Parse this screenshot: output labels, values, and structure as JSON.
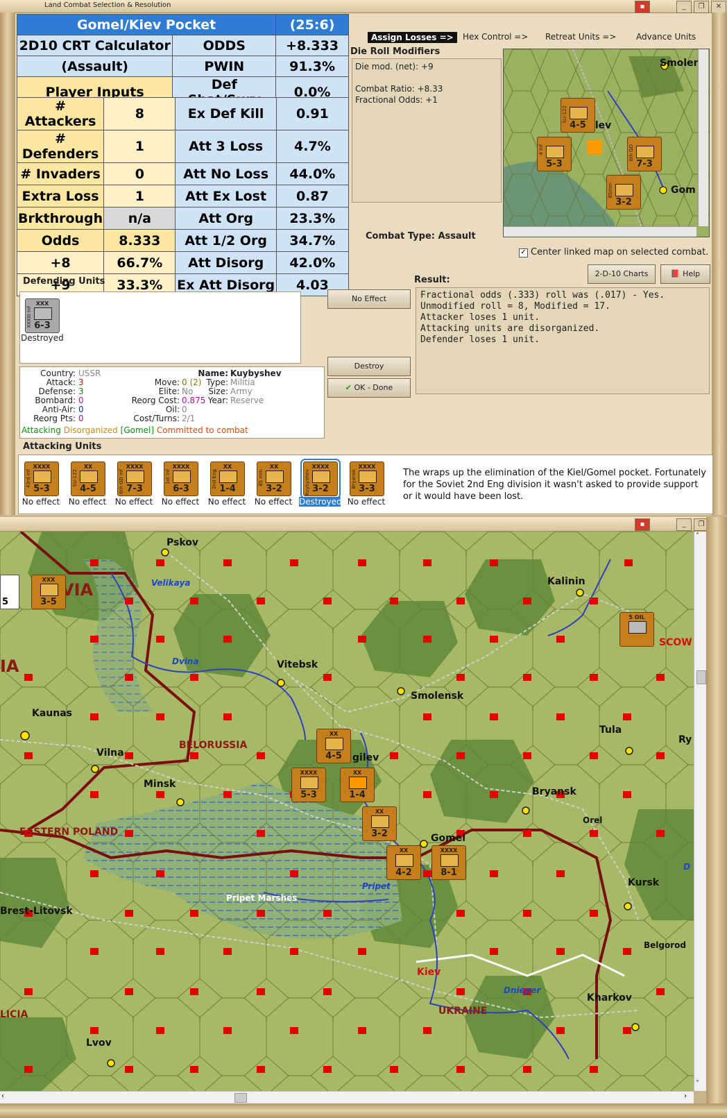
{
  "dialog": {
    "title": "Land Combat Selection & Resolution",
    "tabs": [
      "Assign Losses =>",
      "Hex Control =>",
      "Retreat Units =>",
      "Advance Units"
    ],
    "crt": {
      "rows": [
        [
          "Gomel/Kiev Pocket",
          "",
          "(25:6)"
        ],
        [
          "2D10 CRT Calculator",
          "ODDS",
          "+8.333"
        ],
        [
          "(Assault)",
          "PWIN",
          "91.3%"
        ],
        [
          "Player Inputs",
          "Def Shat/Surv",
          "0.0%"
        ],
        [
          "# Attackers",
          "8",
          "Ex Def Kill",
          "0.91"
        ],
        [
          "# Defenders",
          "1",
          "Att 3 Loss",
          "4.7%"
        ],
        [
          "# Invaders",
          "0",
          "Att No Loss",
          "44.0%"
        ],
        [
          "Extra Loss",
          "1",
          "Att Ex Lost",
          "0.87"
        ],
        [
          "Brkthrough",
          "n/a",
          "Att Org",
          "23.3%"
        ],
        [
          "Odds",
          "8.333",
          "Att 1/2 Org",
          "34.7%"
        ],
        [
          "+8",
          "66.7%",
          "Att Disorg",
          "42.0%"
        ],
        [
          "+9",
          "33.3%",
          "Ex Att Disorg",
          "4.03"
        ]
      ]
    },
    "die_roll": {
      "label": "Die Roll Modifiers",
      "lines": [
        "Die mod. (net): +9",
        "",
        "Combat Ratio: +8.33",
        "Fractional Odds: +1"
      ]
    },
    "combat_type": "Combat Type:  Assault",
    "center_checkbox": "Center linked map on selected combat.",
    "buttons": {
      "charts": "2-D-10 Charts",
      "help": "Help",
      "no_effect": "No Effect",
      "destroy": "Destroy",
      "ok": "OK - Done"
    },
    "defending": {
      "label": "Defending Units",
      "unit": {
        "size": "XXX",
        "name": "XXXIII Inf",
        "str": "6-3",
        "status": "Destroyed"
      }
    },
    "result": {
      "label": "Result:",
      "lines": [
        "Fractional odds (.333) roll was (.017)  - Yes.",
        "Unmodified roll = 8, Modified = 17.",
        "Attacker loses 1 unit.",
        "Attacking units are disorganized.",
        "Defender loses 1 unit."
      ]
    },
    "info": {
      "country_l": "Country:",
      "country_v": "USSR",
      "attack_l": "Attack:",
      "attack_v": "3",
      "defense_l": "Defense:",
      "defense_v": "3",
      "bombard_l": "Bombard:",
      "bombard_v": "0",
      "antiair_l": "Anti-Air:",
      "antiair_v": "0",
      "reorgpts_l": "Reorg Pts:",
      "reorgpts_v": "0",
      "move_l": "Move:",
      "move_v": "0 (2)",
      "elite_l": "Elite:",
      "elite_v": "No",
      "reorgcost_l": "Reorg Cost:",
      "reorgcost_v": "0.875",
      "oil_l": "Oil:",
      "oil_v": "0",
      "costturns_l": "Cost/Turns:",
      "costturns_v": "2/1",
      "name_l": "Name:",
      "name_v": "Kuybyshev",
      "type_l": "Type:",
      "type_v": "Militia",
      "size_l": "Size:",
      "size_v": "Army",
      "year_l": "Year:",
      "year_v": "Reserve",
      "status1": "Attacking",
      "status2": "Disorganized",
      "status3": "[Gomel]",
      "status4": "Committed to combat"
    },
    "attacking": {
      "label": "Attacking Units",
      "units": [
        {
          "size": "XXXX",
          "name": "43rd Inf",
          "str": "5-3",
          "status": "No effect"
        },
        {
          "size": "XX",
          "name": "SU-122",
          "str": "4-5",
          "status": "No effect"
        },
        {
          "size": "XXXX",
          "name": "6th GD Inf",
          "str": "7-3",
          "status": "No effect"
        },
        {
          "size": "XXXX",
          "name": "1st Inf",
          "str": "6-3",
          "status": "No effect"
        },
        {
          "size": "XX",
          "name": "2nd Eng",
          "str": "1-4",
          "status": "No effect"
        },
        {
          "size": "XX",
          "name": "85 mm",
          "str": "3-2",
          "status": "No effect"
        },
        {
          "size": "XXXX",
          "name": "Kuybyshev",
          "str": "3-2",
          "status": "Destroyed"
        },
        {
          "size": "XXXX",
          "name": "Bryansk",
          "str": "3-3",
          "status": "No effect"
        }
      ]
    },
    "note": "The wraps up the elimination of the Kiel/Gomel pocket. Fortunately for the Soviet 2nd Eng division it wasn't asked to provide support or it would have been lost.",
    "minimap": {
      "labels": [
        "Smolens",
        "gilev",
        "Gom"
      ],
      "units": [
        {
          "name": "SU-122",
          "str": "4-5"
        },
        {
          "name": "4 Inf",
          "str": "5-3"
        },
        {
          "name": "6th GD",
          "str": "7-3"
        },
        {
          "name": "85mm",
          "str": "3-2"
        }
      ]
    }
  },
  "map": {
    "cities": [
      "Pskov",
      "Kalinin",
      "Vitebsk",
      "Smolensk",
      "Kaunas",
      "Vilna",
      "Tula",
      "Minsk",
      "Bryansk",
      "Gomel",
      "Orel",
      "Kursk",
      "Brest-Litovsk",
      "Belgorod",
      "Kiev",
      "Kharkov",
      "Lvov",
      "Ry",
      "gilev"
    ],
    "regions": [
      "VIA",
      "IA",
      "BELORUSSIA",
      "EASTERN POLAND",
      "UKRAINE",
      "LICIA",
      "SCOW"
    ],
    "rivers": [
      "Velikaya",
      "Dvina",
      "Pripet",
      "Dnieper",
      "D"
    ],
    "terrain": [
      "Pripet Marshes"
    ],
    "units": [
      {
        "size": "XXX",
        "str": "3-5",
        "flag": "R"
      },
      {
        "size": "XX",
        "str": "4-5"
      },
      {
        "size": "XXXX",
        "str": "5-3"
      },
      {
        "size": "XX",
        "str": "1-4"
      },
      {
        "size": "XX",
        "str": "3-2"
      },
      {
        "size": "XX",
        "str": "4-2"
      },
      {
        "size": "XXXX",
        "str": "8-1"
      },
      {
        "size": "5 OIL",
        "str": ""
      },
      {
        "size": "",
        "str": "5"
      }
    ]
  }
}
